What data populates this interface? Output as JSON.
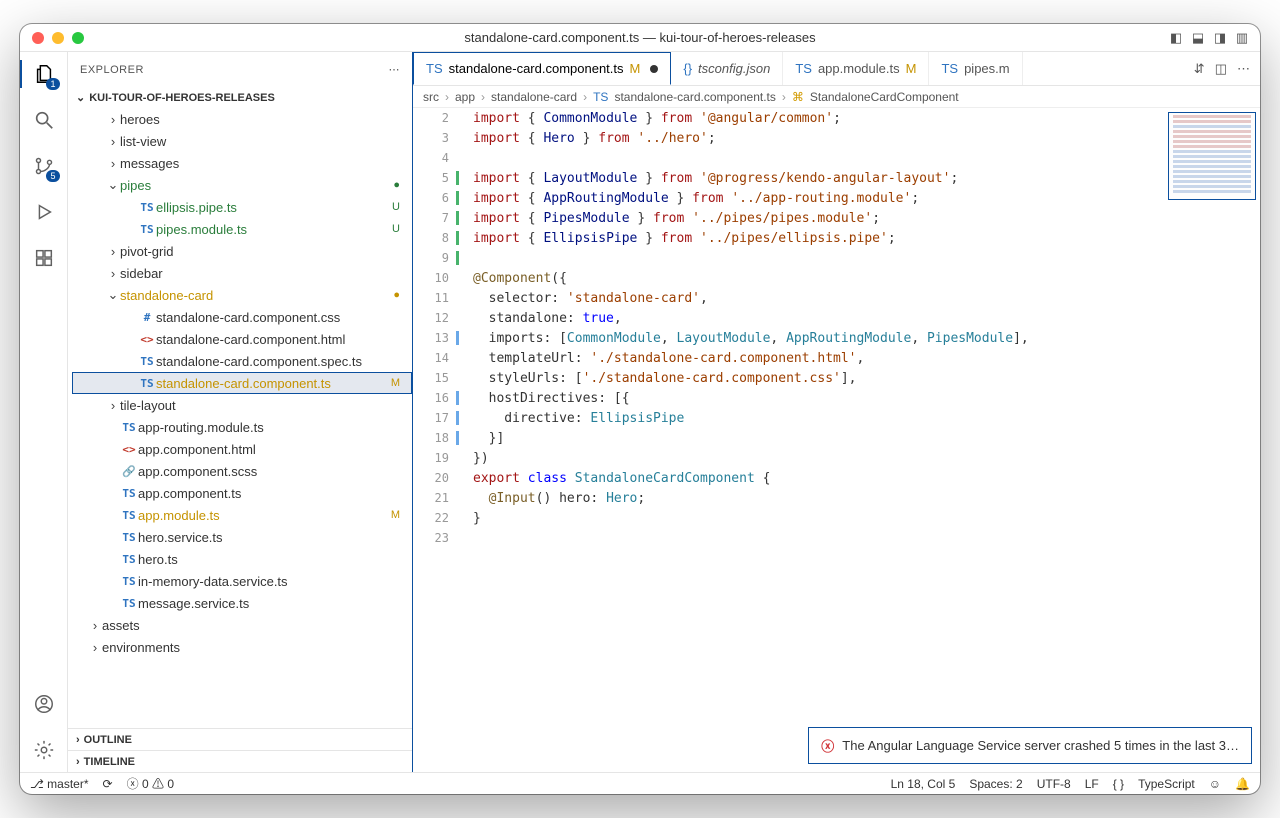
{
  "titlebar": {
    "title": "standalone-card.component.ts — kui-tour-of-heroes-releases"
  },
  "sidebar": {
    "header": "EXPLORER",
    "project": "KUI-TOUR-OF-HEROES-RELEASES",
    "outline": "OUTLINE",
    "timeline": "TIMELINE"
  },
  "activity_badges": {
    "explorer": "1",
    "scm": "5"
  },
  "tree": [
    {
      "depth": 2,
      "chev": "›",
      "name": "heroes",
      "kind": "folder",
      "cls": "",
      "status": ""
    },
    {
      "depth": 2,
      "chev": "›",
      "name": "list-view",
      "kind": "folder",
      "cls": "",
      "status": ""
    },
    {
      "depth": 2,
      "chev": "›",
      "name": "messages",
      "kind": "folder",
      "cls": "",
      "status": ""
    },
    {
      "depth": 2,
      "chev": "⌄",
      "name": "pipes",
      "kind": "folder",
      "cls": "c-unt",
      "status": "●",
      "statusCls": "c-unt"
    },
    {
      "depth": 3,
      "icon": "TS",
      "iconCls": "ic-ts",
      "name": "ellipsis.pipe.ts",
      "cls": "c-unt",
      "status": "U",
      "statusCls": "c-unt"
    },
    {
      "depth": 3,
      "icon": "TS",
      "iconCls": "ic-ts",
      "name": "pipes.module.ts",
      "cls": "c-unt",
      "status": "U",
      "statusCls": "c-unt"
    },
    {
      "depth": 2,
      "chev": "›",
      "name": "pivot-grid",
      "kind": "folder",
      "cls": "",
      "status": ""
    },
    {
      "depth": 2,
      "chev": "›",
      "name": "sidebar",
      "kind": "folder",
      "cls": "",
      "status": ""
    },
    {
      "depth": 2,
      "chev": "⌄",
      "name": "standalone-card",
      "kind": "folder",
      "cls": "c-mod",
      "status": "●",
      "statusCls": "c-mod"
    },
    {
      "depth": 3,
      "icon": "#",
      "iconCls": "ic-css",
      "name": "standalone-card.component.css",
      "cls": "",
      "status": ""
    },
    {
      "depth": 3,
      "icon": "<>",
      "iconCls": "ic-html",
      "name": "standalone-card.component.html",
      "cls": "",
      "status": ""
    },
    {
      "depth": 3,
      "icon": "TS",
      "iconCls": "ic-ts",
      "name": "standalone-card.component.spec.ts",
      "cls": "",
      "status": ""
    },
    {
      "depth": 3,
      "icon": "TS",
      "iconCls": "ic-ts",
      "name": "standalone-card.component.ts",
      "cls": "c-mod",
      "status": "M",
      "statusCls": "c-mod",
      "selected": true
    },
    {
      "depth": 2,
      "chev": "›",
      "name": "tile-layout",
      "kind": "folder",
      "cls": "",
      "status": ""
    },
    {
      "depth": 2,
      "icon": "TS",
      "iconCls": "ic-ts",
      "name": "app-routing.module.ts",
      "cls": "",
      "status": ""
    },
    {
      "depth": 2,
      "icon": "<>",
      "iconCls": "ic-html",
      "name": "app.component.html",
      "cls": "",
      "status": ""
    },
    {
      "depth": 2,
      "icon": "🔗",
      "iconCls": "ic-scss",
      "name": "app.component.scss",
      "cls": "",
      "status": ""
    },
    {
      "depth": 2,
      "icon": "TS",
      "iconCls": "ic-ts",
      "name": "app.component.ts",
      "cls": "",
      "status": ""
    },
    {
      "depth": 2,
      "icon": "TS",
      "iconCls": "ic-ts",
      "name": "app.module.ts",
      "cls": "c-mod",
      "status": "M",
      "statusCls": "c-mod"
    },
    {
      "depth": 2,
      "icon": "TS",
      "iconCls": "ic-ts",
      "name": "hero.service.ts",
      "cls": "",
      "status": ""
    },
    {
      "depth": 2,
      "icon": "TS",
      "iconCls": "ic-ts",
      "name": "hero.ts",
      "cls": "",
      "status": ""
    },
    {
      "depth": 2,
      "icon": "TS",
      "iconCls": "ic-ts",
      "name": "in-memory-data.service.ts",
      "cls": "",
      "status": ""
    },
    {
      "depth": 2,
      "icon": "TS",
      "iconCls": "ic-ts",
      "name": "message.service.ts",
      "cls": "",
      "status": ""
    },
    {
      "depth": 1,
      "chev": "›",
      "name": "assets",
      "kind": "folder",
      "cls": "",
      "status": ""
    },
    {
      "depth": 1,
      "chev": "›",
      "name": "environments",
      "kind": "folder",
      "cls": "",
      "status": ""
    }
  ],
  "tabs": [
    {
      "icon": "TS",
      "label": "standalone-card.component.ts",
      "suffix": "M",
      "modified": true,
      "active": true
    },
    {
      "icon": "{}",
      "label": "tsconfig.json",
      "suffix": "",
      "modified": false,
      "italic": true
    },
    {
      "icon": "TS",
      "label": "app.module.ts",
      "suffix": "M",
      "modified": false
    },
    {
      "icon": "TS",
      "label": "pipes.m",
      "suffix": "",
      "modified": false
    }
  ],
  "breadcrumb": {
    "parts": [
      "src",
      "app",
      "standalone-card",
      "standalone-card.component.ts",
      "StandaloneCardComponent"
    ],
    "icons": [
      "",
      "",
      "",
      "TS",
      "sym"
    ]
  },
  "code": [
    {
      "n": 2,
      "bar": "",
      "html": "<span class='k-red'>import</span> { <span class='k-prop'>CommonModule</span> } <span class='k-red'>from</span> <span class='k-brown'>'@angular/common'</span>;"
    },
    {
      "n": 3,
      "bar": "",
      "html": "<span class='k-red'>import</span> { <span class='k-prop'>Hero</span> } <span class='k-red'>from</span> <span class='k-brown'>'../hero'</span>;"
    },
    {
      "n": 4,
      "bar": "",
      "html": ""
    },
    {
      "n": 5,
      "bar": "bar-green",
      "html": "<span class='k-red'>import</span> { <span class='k-prop'>LayoutModule</span> } <span class='k-red'>from</span> <span class='k-brown'>'@progress/kendo-angular-layout'</span>;"
    },
    {
      "n": 6,
      "bar": "bar-green",
      "html": "<span class='k-red'>import</span> { <span class='k-prop'>AppRoutingModule</span> } <span class='k-red'>from</span> <span class='k-brown'>'../app-routing.module'</span>;"
    },
    {
      "n": 7,
      "bar": "bar-green",
      "html": "<span class='k-red'>import</span> { <span class='k-prop'>PipesModule</span> } <span class='k-red'>from</span> <span class='k-brown'>'../pipes/pipes.module'</span>;"
    },
    {
      "n": 8,
      "bar": "bar-green",
      "html": "<span class='k-red'>import</span> { <span class='k-prop'>EllipsisPipe</span> } <span class='k-red'>from</span> <span class='k-brown'>'../pipes/ellipsis.pipe'</span>;"
    },
    {
      "n": 9,
      "bar": "bar-green",
      "html": ""
    },
    {
      "n": 10,
      "bar": "",
      "html": "<span class='k-dec'>@Component</span>({"
    },
    {
      "n": 11,
      "bar": "",
      "html": "  selector: <span class='k-brown'>'standalone-card'</span>,"
    },
    {
      "n": 12,
      "bar": "",
      "html": "  standalone: <span class='k-blue'>true</span>,"
    },
    {
      "n": 13,
      "bar": "bar-blue",
      "html": "  imports: [<span class='k-type'>CommonModule</span>, <span class='k-type'>LayoutModule</span>, <span class='k-type'>AppRoutingModule</span>, <span class='k-type'>PipesModule</span>],"
    },
    {
      "n": 14,
      "bar": "",
      "html": "  templateUrl: <span class='k-brown'>'./standalone-card.component.html'</span>,"
    },
    {
      "n": 15,
      "bar": "",
      "html": "  styleUrls: [<span class='k-brown'>'./standalone-card.component.css'</span>],"
    },
    {
      "n": 16,
      "bar": "bar-blue",
      "html": "  hostDirectives: [{"
    },
    {
      "n": 17,
      "bar": "bar-blue",
      "html": "    directive: <span class='k-type'>EllipsisPipe</span>"
    },
    {
      "n": 18,
      "bar": "bar-blue",
      "html": "  }]"
    },
    {
      "n": 19,
      "bar": "",
      "html": "})"
    },
    {
      "n": 20,
      "bar": "",
      "html": "<span class='k-red'>export</span> <span class='k-blue'>class</span> <span class='k-type'>StandaloneCardComponent</span> {"
    },
    {
      "n": 21,
      "bar": "",
      "html": "  <span class='k-dec'>@Input</span>() hero: <span class='k-type'>Hero</span>;"
    },
    {
      "n": 22,
      "bar": "",
      "html": "}"
    },
    {
      "n": 23,
      "bar": "",
      "html": ""
    }
  ],
  "notification": {
    "text": "The Angular Language Service server crashed 5 times in the last 3…"
  },
  "statusbar": {
    "branch": "master*",
    "sync_icon": "⟳",
    "errors": "0",
    "warnings": "0",
    "cursor": "Ln 18, Col 5",
    "spaces": "Spaces: 2",
    "encoding": "UTF-8",
    "eol": "LF",
    "lang_icon": "{ }",
    "language": "TypeScript"
  }
}
